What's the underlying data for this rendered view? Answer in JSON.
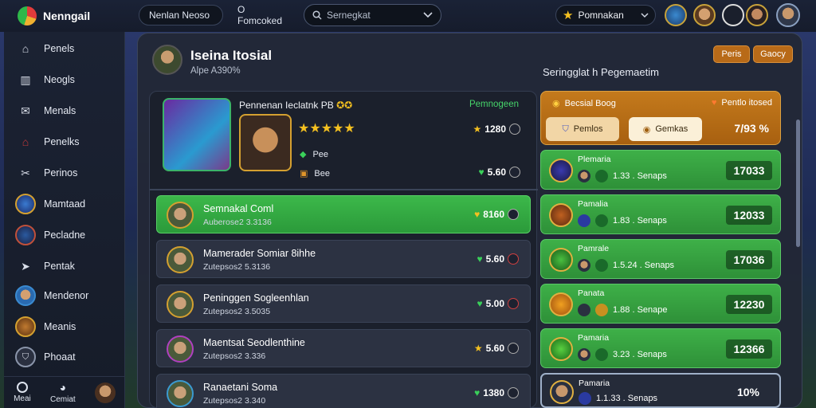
{
  "app": {
    "name": "Nenngail"
  },
  "header": {
    "pill1": "Nenlan Neoso",
    "pill2": "O Fomcoked",
    "search_placeholder": "Sernegkat",
    "dropdown_label": "Pomnakan"
  },
  "sidebar": {
    "items": [
      {
        "label": "Penels",
        "icon": "home-icon"
      },
      {
        "label": "Neogls",
        "icon": "chart-icon"
      },
      {
        "label": "Menals",
        "icon": "mail-icon"
      },
      {
        "label": "Penelks",
        "icon": "house-icon"
      },
      {
        "label": "Perinos",
        "icon": "tools-icon"
      },
      {
        "label": "Mamtaad",
        "icon": "compass-icon"
      },
      {
        "label": "Pecladne",
        "icon": "globe-icon"
      },
      {
        "label": "Pentak",
        "icon": "arrow-icon"
      },
      {
        "label": "Mendenor",
        "icon": "character-icon"
      },
      {
        "label": "Meanis",
        "icon": "lion-icon"
      },
      {
        "label": "Phoaat",
        "icon": "shield-icon"
      }
    ],
    "bottom": [
      {
        "label": "Meai"
      },
      {
        "label": "Cemiat"
      }
    ]
  },
  "panel": {
    "title": "Iseina Itosial",
    "subtitle": "Alpe A390%",
    "btn_a": "Peris",
    "btn_b": "Gaocy",
    "right_heading": "Seringglat h Pegemaetim"
  },
  "featured": {
    "title": "Pennenan Ieclatnk PB",
    "tag": "Pemnogeen",
    "line1": "Pee",
    "line2": "Bee",
    "score1": "1280",
    "score2": "5.60"
  },
  "rows": [
    {
      "name": "Semnakal Coml",
      "sub": "Auberose2 3.3136",
      "score": "8160",
      "active": true
    },
    {
      "name": "Mamerader Somiar 8ihhe",
      "sub": "Zutepsos2 5.3136",
      "score": "5.60",
      "active": false
    },
    {
      "name": "Peninggen Sogleenhlan",
      "sub": "Zutepsos2 3.5035",
      "score": "5.00",
      "active": false
    },
    {
      "name": "Maentsat Seodlenthine",
      "sub": "Zutepsos2 3.336",
      "score": "5.60",
      "active": false
    },
    {
      "name": "Ranaetani Soma",
      "sub": "Zutepsos2 3.340",
      "score": "1380",
      "active": false
    }
  ],
  "right_panel": {
    "head_left": "Becsial Boog",
    "head_right": "Pentlo itosed",
    "tab1": "Pemlos",
    "tab2": "Gemkas",
    "head_value": "7/93 %"
  },
  "right_rows": [
    {
      "name": "Plemaria",
      "meta": "1.33 . Senaps",
      "value": "17033",
      "dark": false
    },
    {
      "name": "Pamalia",
      "meta": "1.83 . Senaps",
      "value": "12033",
      "dark": false
    },
    {
      "name": "Pamrale",
      "meta": "1.5.24 . Senaps",
      "value": "17036",
      "dark": false
    },
    {
      "name": "Panata",
      "meta": "1.88 . Senape",
      "value": "12230",
      "dark": false
    },
    {
      "name": "Pamaria",
      "meta": "3.23 . Senaps",
      "value": "12366",
      "dark": false
    },
    {
      "name": "Pamaria",
      "meta": "1.1.33 . Senaps",
      "value": "10%",
      "dark": true
    }
  ]
}
